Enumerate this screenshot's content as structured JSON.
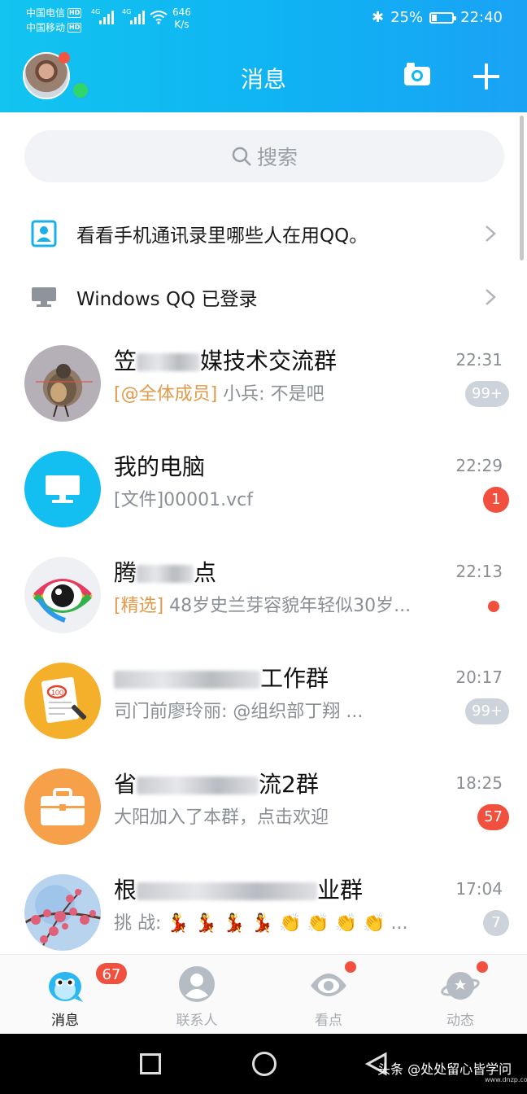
{
  "status_bar": {
    "carrier1": "中国电信",
    "carrier2": "中国移动",
    "hd": "HD",
    "net1": "4G",
    "net2": "4G",
    "speed_value": "646",
    "speed_unit": "K/s",
    "battery": "25%",
    "time": "22:40"
  },
  "header": {
    "title": "消息",
    "camera_icon": "camera-icon",
    "add_icon": "plus-icon"
  },
  "search": {
    "placeholder": "搜索"
  },
  "notices": [
    {
      "text": "看看手机通讯录里哪些人在用QQ。",
      "icon": "contact-card-icon"
    },
    {
      "text": "Windows QQ 已登录",
      "icon": "monitor-icon"
    }
  ],
  "chats": [
    {
      "name_visible": "媒技术交流群",
      "name_prefix": "笠",
      "tag": "[@全体成员]",
      "msg": " 小兵: 不是吧",
      "time": "22:31",
      "badge": "99+",
      "badge_style": "gray"
    },
    {
      "name_visible": "我的电脑",
      "name_prefix": "",
      "tag": "",
      "msg": "[文件]00001.vcf",
      "time": "22:29",
      "badge": "1",
      "badge_style": "red"
    },
    {
      "name_visible": "点",
      "name_prefix": "腾",
      "tag": "[精选]",
      "msg": " 48岁史兰芽容貌年轻似30岁...",
      "time": "22:13",
      "badge": "",
      "badge_style": "dot"
    },
    {
      "name_visible": "工作群",
      "name_prefix": "",
      "tag": "",
      "msg": "司门前廖玲丽: @组织部丁翔 ...",
      "time": "20:17",
      "badge": "99+",
      "badge_style": "gray"
    },
    {
      "name_visible": "流2群",
      "name_prefix": "省",
      "tag": "",
      "msg": "大阳加入了本群，点击欢迎",
      "time": "18:25",
      "badge": "57",
      "badge_style": "red"
    },
    {
      "name_visible": "业群",
      "name_prefix": "根",
      "tag": "",
      "msg": "挑 战: 💃 💃 💃 💃 👏 👏 👏 👏 ...",
      "time": "17:04",
      "badge": "7",
      "badge_style": "gray"
    }
  ],
  "tabs": [
    {
      "label": "消息",
      "badge": "67",
      "icon": "penguin-icon",
      "active": true
    },
    {
      "label": "联系人",
      "badge": "",
      "icon": "person-icon",
      "active": false
    },
    {
      "label": "看点",
      "badge": "",
      "icon": "eye-icon",
      "active": false
    },
    {
      "label": "动态",
      "badge": "",
      "icon": "planet-icon",
      "active": false
    }
  ],
  "watermark": "头条 @处处留心皆学问",
  "watermark_site": "www.dnzp.com",
  "colors": {
    "header": "#12c4ef",
    "badge_red": "#f2503f",
    "badge_gray": "#cdd3db",
    "tag_orange": "#e09a4a"
  }
}
